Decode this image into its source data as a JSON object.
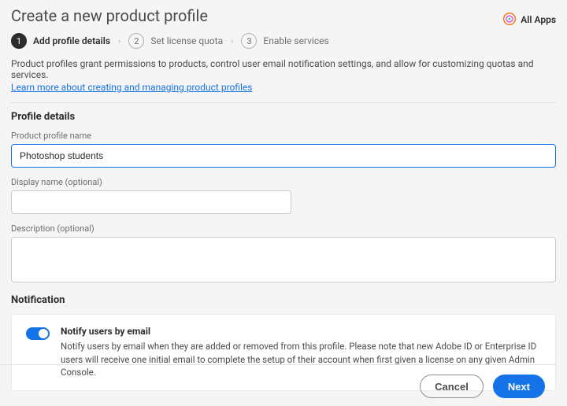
{
  "header": {
    "title": "Create a new product profile",
    "all_apps_label": "All Apps"
  },
  "stepper": {
    "step1": {
      "num": "1",
      "label": "Add profile details"
    },
    "step2": {
      "num": "2",
      "label": "Set license quota"
    },
    "step3": {
      "num": "3",
      "label": "Enable services"
    }
  },
  "intro": {
    "text": "Product profiles grant permissions to products, control user email notification settings, and allow for customizing quotas and services.",
    "learn_more": "Learn more about creating and managing product profiles"
  },
  "profile_details": {
    "heading": "Profile details",
    "name_label": "Product profile name",
    "name_value": "Photoshop students",
    "display_name_label": "Display name (optional)",
    "display_name_value": "",
    "description_label": "Description (optional)",
    "description_value": ""
  },
  "notification": {
    "heading": "Notification",
    "toggle_on": true,
    "title": "Notify users by email",
    "desc": "Notify users by email when they are added or removed from this profile. Please note that new Adobe ID or Enterprise ID users will receive one initial email to complete the setup of their account when first given a license on any given Admin Console."
  },
  "footer": {
    "cancel": "Cancel",
    "next": "Next"
  }
}
